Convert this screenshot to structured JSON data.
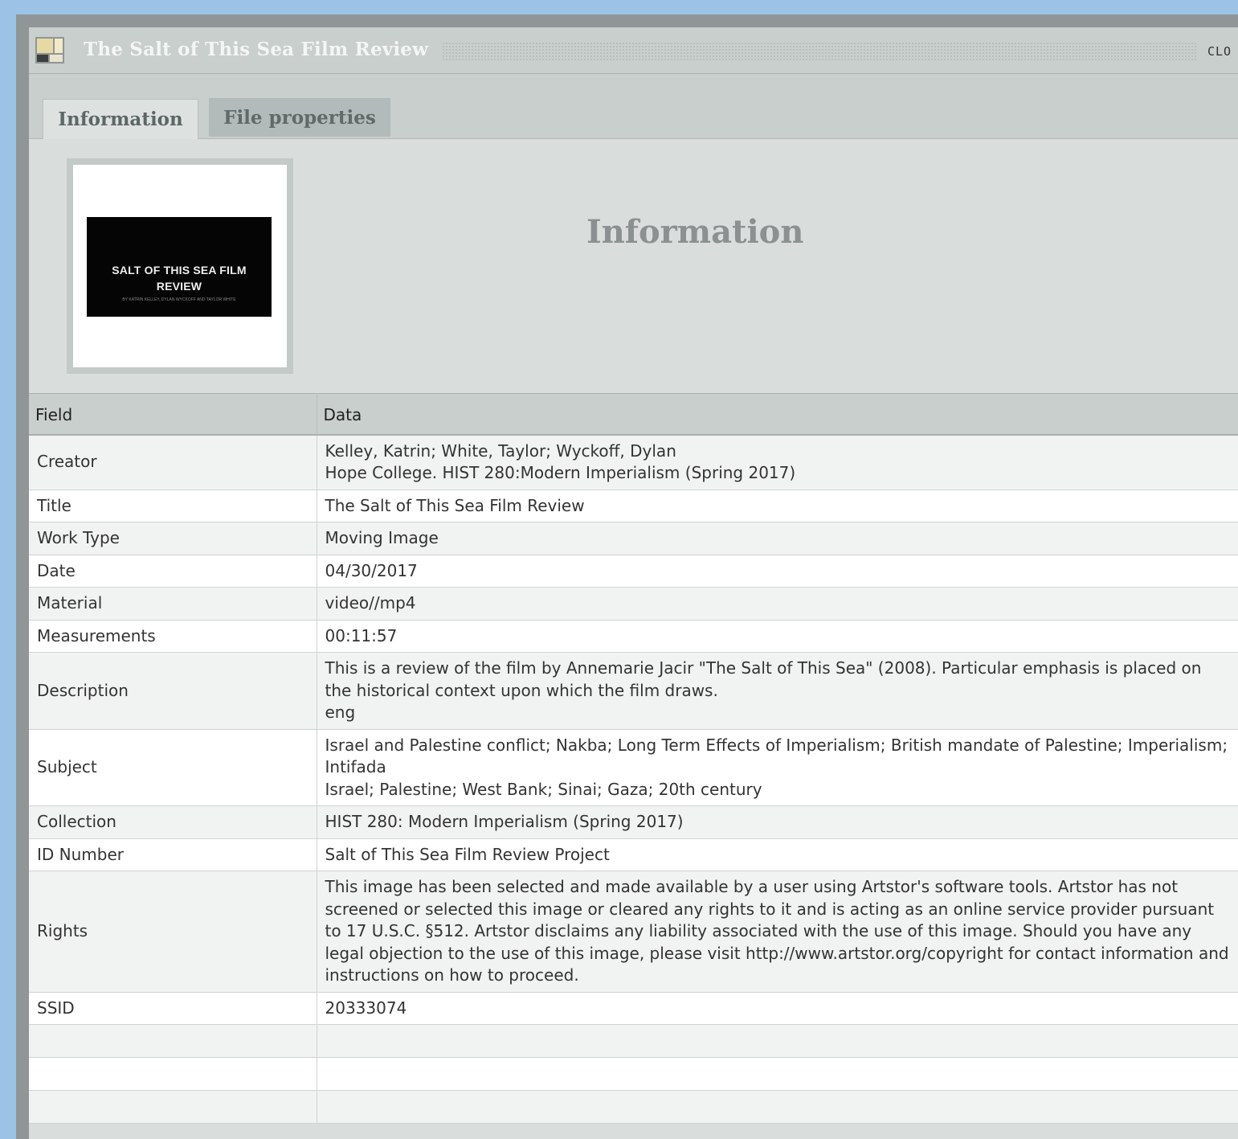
{
  "window": {
    "title": "The Salt of This Sea Film Review",
    "close_label": "CLO"
  },
  "tabs": [
    {
      "label": "Information",
      "active": true
    },
    {
      "label": "File properties",
      "active": false
    }
  ],
  "info": {
    "heading": "Information",
    "thumbnail": {
      "title_line1": "SALT OF THIS SEA FILM",
      "title_line2": "REVIEW",
      "subtitle": "BY KATRIN KELLEY, DYLAN WYCKOFF AND TAYLOR WHITE"
    }
  },
  "table": {
    "headers": [
      "Field",
      "Data"
    ],
    "rows": [
      {
        "field": "Creator",
        "data": "Kelley, Katrin; White, Taylor; Wyckoff, Dylan\nHope College. HIST 280:Modern Imperialism (Spring 2017)"
      },
      {
        "field": "Title",
        "data": "The Salt of This Sea Film Review"
      },
      {
        "field": "Work Type",
        "data": "Moving Image"
      },
      {
        "field": "Date",
        "data": "04/30/2017"
      },
      {
        "field": "Material",
        "data": "video//mp4"
      },
      {
        "field": "Measurements",
        "data": "00:11:57"
      },
      {
        "field": "Description",
        "data": "This is a review of the film by Annemarie Jacir \"The Salt of This Sea\" (2008). Particular emphasis is placed on the historical context upon which the film draws.\neng"
      },
      {
        "field": "Subject",
        "data": "Israel and Palestine conflict; Nakba; Long Term Effects of Imperialism; British mandate of Palestine; Imperialism; Intifada\nIsrael; Palestine; West Bank; Sinai; Gaza; 20th century"
      },
      {
        "field": "Collection",
        "data": "HIST 280: Modern Imperialism (Spring 2017)"
      },
      {
        "field": "ID Number",
        "data": "Salt of This Sea Film Review Project"
      },
      {
        "field": "Rights",
        "data": "This image has been selected and made available by a user using Artstor's software tools. Artstor has not screened or selected this image or cleared any rights to it and is acting as an online service provider pursuant to 17 U.S.C. §512. Artstor disclaims any liability associated with the use of this image. Should you have any legal objection to the use of this image, please visit http://www.artstor.org/copyright for contact information and instructions on how to proceed."
      },
      {
        "field": "SSID",
        "data": "20333074"
      },
      {
        "field": "",
        "data": ""
      },
      {
        "field": "",
        "data": ""
      },
      {
        "field": "",
        "data": ""
      }
    ]
  }
}
